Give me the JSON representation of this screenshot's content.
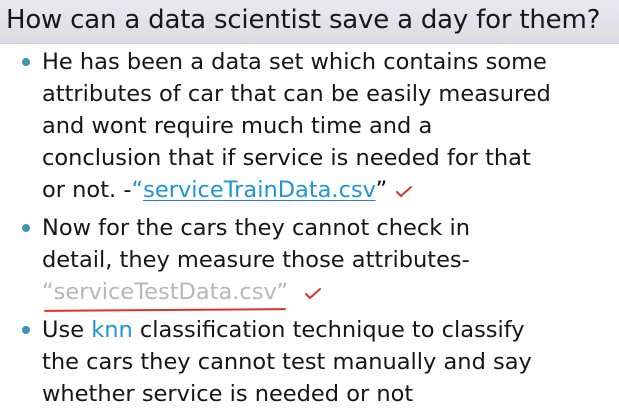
{
  "title": "How can a data scientist save a day for them?",
  "bullets": [
    {
      "lines": [
        "He has been a data set which contains some",
        "attributes of car that can be easily measured",
        "and wont require much time and a",
        "conclusion that if service is needed for that"
      ],
      "last_line_prefix": "or not.  -",
      "open_quote": "“",
      "file_name": "serviceTrainData.csv",
      "close_quote": "”"
    },
    {
      "lines": [
        "Now for the cars they cannot check in",
        "detail, they measure those attributes-"
      ],
      "file_line": "“serviceTestData.csv”"
    },
    {
      "prefix": "Use ",
      "highlight": "knn",
      "line1_suffix": " classification technique to classify",
      "lines": [
        "the cars they cannot test manually and say",
        "whether service is needed or not"
      ]
    }
  ],
  "colors": {
    "bullet_dot": "#3f95ad",
    "link_blue": "#1d95d6",
    "grey_text": "#b7b7b7",
    "annotation_red": "#d9342b"
  }
}
